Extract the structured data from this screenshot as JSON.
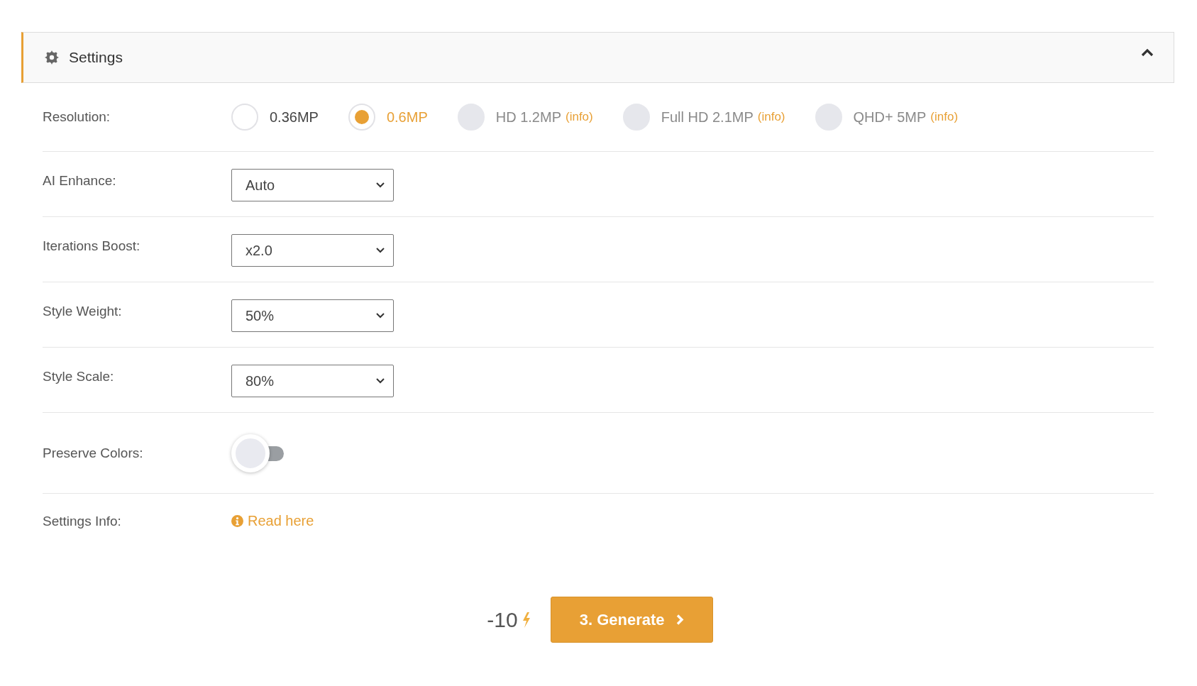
{
  "panel": {
    "title": "Settings",
    "expanded": true
  },
  "rows": [
    {
      "kind": "radio",
      "label": "Resolution:",
      "options": [
        {
          "label": "0.36MP",
          "selected": false,
          "disabled": false
        },
        {
          "label": "0.6MP",
          "selected": true,
          "disabled": false
        },
        {
          "label": "HD 1.2MP",
          "info": "(info)",
          "selected": false,
          "disabled": true
        },
        {
          "label": "Full HD 2.1MP",
          "info": "(info)",
          "selected": false,
          "disabled": true
        },
        {
          "label": "QHD+ 5MP",
          "info": "(info)",
          "selected": false,
          "disabled": true
        }
      ]
    },
    {
      "kind": "select",
      "label": "AI Enhance:",
      "value": "Auto"
    },
    {
      "kind": "select",
      "label": "Iterations Boost:",
      "value": "x2.0"
    },
    {
      "kind": "select",
      "label": "Style Weight:",
      "value": "50%"
    },
    {
      "kind": "select",
      "label": "Style Scale:",
      "value": "80%"
    },
    {
      "kind": "toggle",
      "label": "Preserve Colors:",
      "on": false
    },
    {
      "kind": "link",
      "label": "Settings Info:",
      "link": "Read here"
    }
  ],
  "cost": "-10",
  "generate_button": "3. Generate"
}
